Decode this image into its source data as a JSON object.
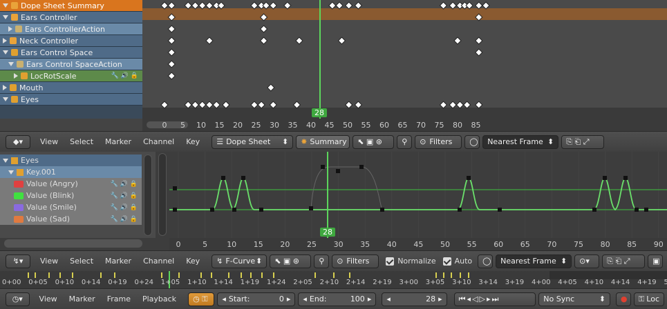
{
  "dopesheet": {
    "channels": [
      {
        "label": "Dope Sheet Summary",
        "icon": "summary-icon",
        "expanded": true,
        "style": "summary"
      },
      {
        "label": "Ears Controller",
        "icon": "armature-icon",
        "expanded": true,
        "style": "object"
      },
      {
        "label": "Ears ControllerAction",
        "icon": "action-icon",
        "expanded": false,
        "style": "action"
      },
      {
        "label": "Neck Controller",
        "icon": "armature-icon",
        "expanded": false,
        "style": "object"
      },
      {
        "label": "Ears Control Space",
        "icon": "empty-icon",
        "expanded": true,
        "style": "object"
      },
      {
        "label": "Ears Control SpaceAction",
        "icon": "action-icon",
        "expanded": true,
        "style": "action"
      },
      {
        "label": "LocRotScale",
        "icon": "group-icon",
        "expanded": false,
        "style": "group"
      },
      {
        "label": "Mouth",
        "icon": "empty-icon",
        "expanded": false,
        "style": "object"
      },
      {
        "label": "Eyes",
        "icon": "empty-icon",
        "expanded": true,
        "style": "object"
      }
    ],
    "ruler": [
      "0",
      "5",
      "10",
      "15",
      "20",
      "25",
      "30",
      "35",
      "40",
      "45",
      "50",
      "55",
      "60",
      "65",
      "70",
      "75",
      "80",
      "85"
    ],
    "current_frame": "28",
    "header": {
      "menus": [
        "View",
        "Select",
        "Marker",
        "Channel",
        "Key"
      ],
      "mode": "Dope Sheet",
      "summary": "Summary",
      "filters": "Filters",
      "snap": "Nearest Frame"
    }
  },
  "graph": {
    "channels": [
      {
        "label": "Eyes",
        "style": "object",
        "color": ""
      },
      {
        "label": "Key.001",
        "style": "key",
        "color": ""
      },
      {
        "label": "Value (Angry)",
        "style": "fcurve",
        "color": "#e04040"
      },
      {
        "label": "Value (Blink)",
        "style": "fcurve",
        "color": "#40e040"
      },
      {
        "label": "Value (Smile)",
        "style": "fcurve",
        "color": "#8a6ae0"
      },
      {
        "label": "Value (Sad)",
        "style": "fcurve",
        "color": "#e07a40"
      }
    ],
    "ruler": [
      "0",
      "5",
      "10",
      "15",
      "20",
      "25",
      "30",
      "35",
      "40",
      "45",
      "50",
      "55",
      "60",
      "65",
      "70",
      "75",
      "80",
      "85",
      "90"
    ],
    "current_frame": "28",
    "header": {
      "menus": [
        "View",
        "Select",
        "Marker",
        "Channel",
        "Key"
      ],
      "mode": "F-Curve",
      "filters": "Filters",
      "normalize": "Normalize",
      "auto": "Auto",
      "snap": "Nearest Frame"
    }
  },
  "timecode_ruler": [
    "0+00",
    "0+05",
    "0+10",
    "0+14",
    "0+19",
    "0+24",
    "1+05",
    "1+10",
    "1+14",
    "1+19",
    "1+24",
    "2+05",
    "2+10",
    "2+14",
    "2+19",
    "3+00",
    "3+05",
    "3+10",
    "3+14",
    "3+19",
    "4+00",
    "4+05",
    "4+10",
    "4+14",
    "4+19",
    "5+00"
  ],
  "timeline": {
    "menus": [
      "View",
      "Marker",
      "Frame",
      "Playback"
    ],
    "start_label": "Start:",
    "start_value": "0",
    "end_label": "End:",
    "end_value": "100",
    "current": "28",
    "sync": "No Sync",
    "keying": "Loc"
  },
  "colors": {
    "summary": "#d9751e",
    "highlight": "#5a7a9a",
    "accent": "#3fa83f",
    "playhead": "#5cd65c"
  }
}
